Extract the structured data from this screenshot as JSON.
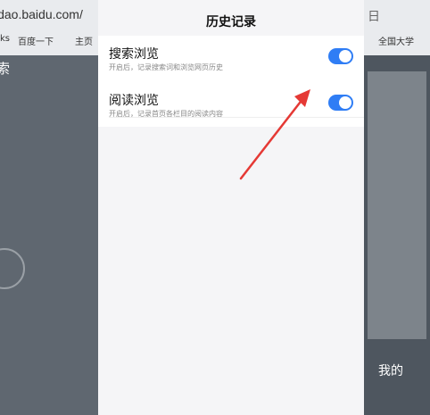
{
  "background": {
    "url_fragment": "ldao.baidu.com/",
    "left_title": "索",
    "right_top_text": "日 ",
    "right_bottom_text": "我的",
    "bookmarks": [
      {
        "label": "ks"
      },
      {
        "label": "百度一下"
      },
      {
        "label": "主页"
      },
      {
        "label": "全国大学"
      }
    ]
  },
  "header": {
    "title": "历史记录"
  },
  "settings": [
    {
      "label": "搜索浏览",
      "desc": "开启后，记录搜索词和浏览网页历史",
      "enabled": true
    },
    {
      "label": "阅读浏览",
      "desc": "开启后，记录首页各栏目的阅读内容",
      "enabled": true
    }
  ],
  "colors": {
    "toggle_on": "#2f7df5",
    "arrow": "#e53935"
  }
}
